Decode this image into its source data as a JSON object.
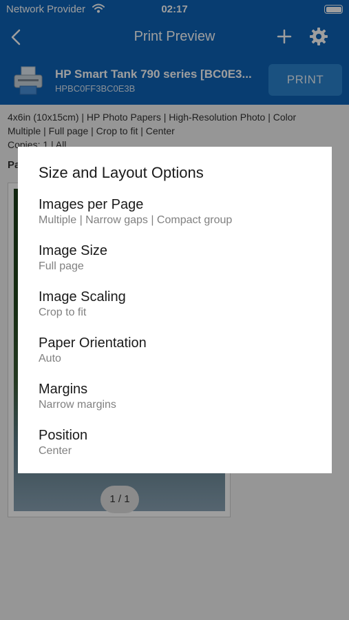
{
  "status_bar": {
    "carrier": "Network Provider",
    "time": "02:17"
  },
  "nav": {
    "title": "Print Preview"
  },
  "printer": {
    "name": "HP Smart Tank 790 series [BC0E3...",
    "id": "HPBC0FF3BC0E3B",
    "print_label": "PRINT"
  },
  "summary": {
    "line1": "4x6in (10x15cm) | HP Photo Papers | High-Resolution Photo | Color",
    "line2": "Multiple | Full page | Crop to fit | Center",
    "line3": "Copies: 1 | All"
  },
  "preview": {
    "page_label": "Pa",
    "page_indicator": "1 / 1"
  },
  "dialog": {
    "title": "Size and Layout Options",
    "options": [
      {
        "label": "Images per Page",
        "value": "Multiple | Narrow gaps | Compact group"
      },
      {
        "label": "Image Size",
        "value": "Full page"
      },
      {
        "label": "Image Scaling",
        "value": "Crop to fit"
      },
      {
        "label": "Paper Orientation",
        "value": "Auto"
      },
      {
        "label": "Margins",
        "value": "Narrow margins"
      },
      {
        "label": "Position",
        "value": "Center"
      }
    ]
  },
  "colors": {
    "header": "#0e63b6",
    "print_button": "#2a83cf",
    "overlay": "#000000"
  },
  "icons": {
    "wifi": "wifi-icon",
    "battery": "battery-icon",
    "back": "chevron-left-icon",
    "add": "plus-icon",
    "settings": "gear-icon",
    "printer": "printer-icon"
  }
}
